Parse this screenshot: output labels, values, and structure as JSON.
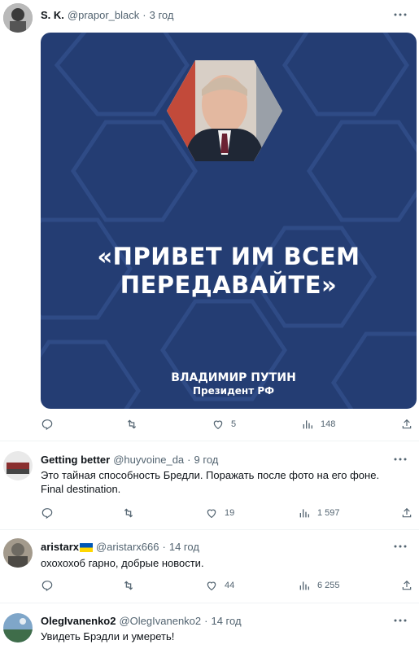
{
  "tweets": [
    {
      "name": "S. K.",
      "handle": "@prapor_black",
      "dot": "·",
      "time": "3 год",
      "card": {
        "quote_line1": "«ПРИВЕТ ИМ ВСЕМ",
        "quote_line2": "ПЕРЕДАВАЙТЕ»",
        "author_name": "ВЛАДИМИР ПУТИН",
        "author_title": "Президент РФ"
      },
      "actions": {
        "reply": "",
        "retweet": "",
        "like": "5",
        "views": "148"
      }
    },
    {
      "name": "Getting better",
      "handle": "@huyvoine_da",
      "dot": "·",
      "time": "9 год",
      "text": "Это тайная способность Бредли. Поражать после фото на его фоне. Final destination.",
      "actions": {
        "reply": "",
        "retweet": "",
        "like": "19",
        "views": "1 597"
      }
    },
    {
      "name": "aristarx",
      "handle": "@aristarx666",
      "dot": "·",
      "time": "14 год",
      "text": "охохохоб гарно, добрые новости.",
      "actions": {
        "reply": "",
        "retweet": "",
        "like": "44",
        "views": "6 255"
      }
    },
    {
      "name": "OlegIvanenko2",
      "handle": "@OlegIvanenko2",
      "dot": "·",
      "time": "14 год",
      "text": "Увидеть Брэдли и умереть!"
    }
  ],
  "colors": {
    "card_bg": "#243d73",
    "muted": "#536471",
    "text": "#0f1419"
  },
  "icons": [
    "reply-icon",
    "retweet-icon",
    "like-icon",
    "views-icon",
    "share-icon",
    "more-icon",
    "ukraine-flag-icon"
  ]
}
